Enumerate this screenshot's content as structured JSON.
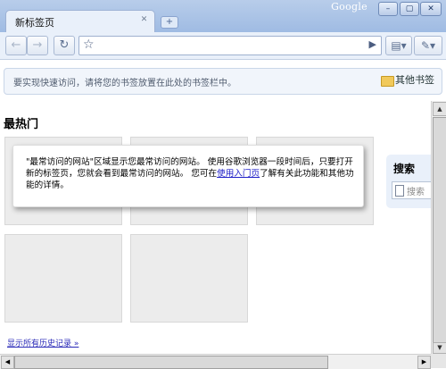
{
  "window": {
    "brand": "Google",
    "buttons": {
      "minimize": "–",
      "maximize": "▢",
      "close": "✕"
    }
  },
  "tabs": [
    {
      "title": "新标签页",
      "close_icon": "close-icon"
    }
  ],
  "new_tab_icon": "+",
  "toolbar": {
    "back_icon": "←",
    "forward_icon": "→",
    "reload_icon": "↻",
    "star_icon": "☆",
    "go_icon": "▶",
    "page_menu_icon": "▤▾",
    "wrench_menu_icon": "✎▾",
    "address_value": ""
  },
  "bookmarks_bar": {
    "hint": "要实现快速访问，请将您的书签放置在此处的书签栏中。",
    "other_bookmarks": "其他书签"
  },
  "main": {
    "section_title": "最热门",
    "info": {
      "text": "\"最常访问的网站\"区域显示您最常访问的网站。 使用谷歌浏览器一段时间后，只要打开新的标签页，您就会看到最常访问的网站。 您可在",
      "link": "使用入门页",
      "suffix": "了解有关此功能和其他功能的详情。"
    },
    "search": {
      "title": "搜索",
      "placeholder": "搜索"
    },
    "history_link": "显示所有历史记录 »"
  },
  "scrollbar": {
    "up": "▲",
    "down": "▼",
    "left": "◀",
    "right": "▶"
  },
  "colors": {
    "titlebar": "#a9c2e6",
    "toolbar": "#e9f0fa",
    "link": "#2020c8"
  }
}
